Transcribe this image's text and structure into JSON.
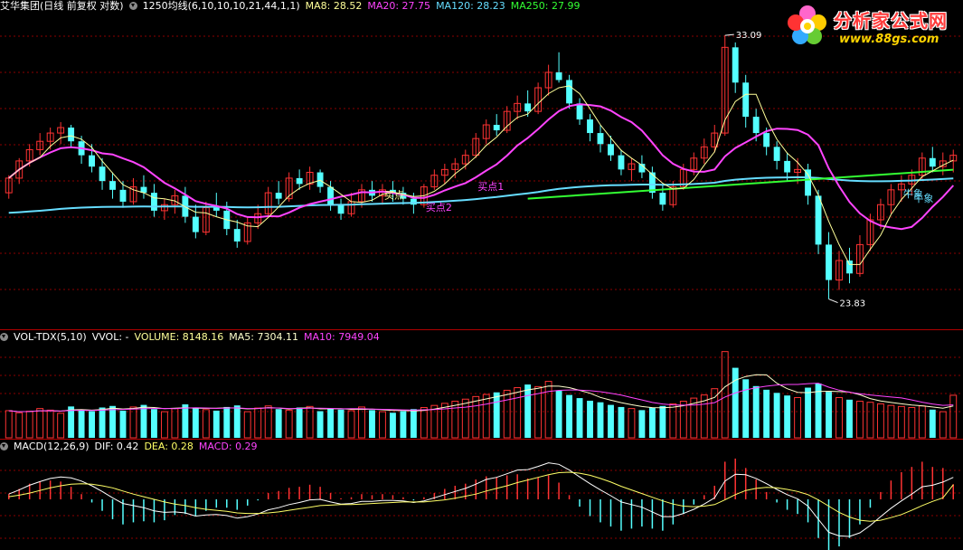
{
  "colors": {
    "up": "#ff3333",
    "down": "#54ffff",
    "ma8": "#ffff99",
    "ma20": "#ff44ff",
    "ma120": "#66ddff",
    "ma250": "#33ff33",
    "grid": "#8b0000",
    "text_white": "#ffffff"
  },
  "header": {
    "stock": "艾华集团(日线 前复权 对数)",
    "ma_set": "1250均线(6,10,10,10,21,44,1,1)",
    "ma8": "MA8: 28.52",
    "ma20": "MA20: 27.75",
    "ma120": "MA120: 28.23",
    "ma250": "MA250: 27.99"
  },
  "volume_header": {
    "name": "VOL-TDX(5,10)",
    "vvol": "VVOL: -",
    "volume": "VOLUME: 8148.16",
    "ma5": "MA5: 7304.11",
    "ma10": "MA10: 7949.04"
  },
  "macd_header": {
    "name": "MACD(12,26,9)",
    "dif": "DIF: 0.42",
    "dea": "DEA: 0.28",
    "macd": "MACD: 0.29"
  },
  "logo": {
    "title": "分析家公式网",
    "url": "www.88gs.com"
  },
  "chart_data": [
    {
      "type": "candlestick",
      "panel": "price",
      "scale": "log",
      "ylim": [
        23.0,
        34.0
      ],
      "annotations": [
        {
          "text": "33.09",
          "bar": 69,
          "price": 33.09
        },
        {
          "text": "23.83",
          "bar": 79,
          "price": 23.83
        },
        {
          "text": "买点1",
          "bar": 45,
          "price": 27.3
        },
        {
          "text": "买点2",
          "bar": 40,
          "price": 26.6
        },
        {
          "text": "买点",
          "bar": 36,
          "price": 27.0
        },
        {
          "text": "牛象",
          "bar": 86,
          "price": 27.05
        },
        {
          "text": "牛象",
          "bar": 87,
          "price": 26.9
        }
      ],
      "candles": [
        [
          27.2,
          27.8,
          27.0,
          27.7
        ],
        [
          27.7,
          28.4,
          27.5,
          28.3
        ],
        [
          28.3,
          28.9,
          28.1,
          28.7
        ],
        [
          28.7,
          29.3,
          28.5,
          29.0
        ],
        [
          29.0,
          29.5,
          28.7,
          29.3
        ],
        [
          29.3,
          29.7,
          28.9,
          29.5
        ],
        [
          29.5,
          29.6,
          28.8,
          29.0
        ],
        [
          29.0,
          29.2,
          28.2,
          28.5
        ],
        [
          28.5,
          28.9,
          27.9,
          28.1
        ],
        [
          28.1,
          28.4,
          27.3,
          27.6
        ],
        [
          27.6,
          27.9,
          27.0,
          27.3
        ],
        [
          27.3,
          27.6,
          26.7,
          26.9
        ],
        [
          26.9,
          27.7,
          26.8,
          27.4
        ],
        [
          27.4,
          27.8,
          27.0,
          27.2
        ],
        [
          27.2,
          27.5,
          26.4,
          26.6
        ],
        [
          26.6,
          27.0,
          26.3,
          26.8
        ],
        [
          26.8,
          27.3,
          26.5,
          27.1
        ],
        [
          27.1,
          27.4,
          26.2,
          26.4
        ],
        [
          26.4,
          26.8,
          25.7,
          25.9
        ],
        [
          25.9,
          26.9,
          25.8,
          26.7
        ],
        [
          26.7,
          27.2,
          26.4,
          26.6
        ],
        [
          26.6,
          26.9,
          25.8,
          26.0
        ],
        [
          26.0,
          26.3,
          25.4,
          25.6
        ],
        [
          25.6,
          26.4,
          25.5,
          26.2
        ],
        [
          26.2,
          26.8,
          26.0,
          26.5
        ],
        [
          26.5,
          27.4,
          26.4,
          27.2
        ],
        [
          27.2,
          27.6,
          26.8,
          27.0
        ],
        [
          27.0,
          27.9,
          26.9,
          27.7
        ],
        [
          27.7,
          28.0,
          27.3,
          27.5
        ],
        [
          27.5,
          28.1,
          27.3,
          27.9
        ],
        [
          27.9,
          28.0,
          27.2,
          27.4
        ],
        [
          27.4,
          27.6,
          26.6,
          26.8
        ],
        [
          26.8,
          27.0,
          26.3,
          26.5
        ],
        [
          26.5,
          27.2,
          26.4,
          26.9
        ],
        [
          26.9,
          27.5,
          26.7,
          27.3
        ],
        [
          27.3,
          27.6,
          26.9,
          27.1
        ],
        [
          27.1,
          27.5,
          26.8,
          27.3
        ],
        [
          27.3,
          27.6,
          26.9,
          27.2
        ],
        [
          27.2,
          27.4,
          26.8,
          27.0
        ],
        [
          27.0,
          27.2,
          26.5,
          26.8
        ],
        [
          26.8,
          27.5,
          26.7,
          27.4
        ],
        [
          27.4,
          28.0,
          27.3,
          27.8
        ],
        [
          27.8,
          28.2,
          27.5,
          28.0
        ],
        [
          28.0,
          28.4,
          27.7,
          28.2
        ],
        [
          28.2,
          28.7,
          28.0,
          28.5
        ],
        [
          28.5,
          29.3,
          28.4,
          29.1
        ],
        [
          29.1,
          29.8,
          28.9,
          29.6
        ],
        [
          29.6,
          30.0,
          29.2,
          29.4
        ],
        [
          29.4,
          30.3,
          29.3,
          30.1
        ],
        [
          30.1,
          30.7,
          29.8,
          30.4
        ],
        [
          30.4,
          30.9,
          29.9,
          30.1
        ],
        [
          30.1,
          31.2,
          30.0,
          31.0
        ],
        [
          31.0,
          31.9,
          30.7,
          31.6
        ],
        [
          31.6,
          32.4,
          31.2,
          31.3
        ],
        [
          31.3,
          31.5,
          30.2,
          30.4
        ],
        [
          30.4,
          30.6,
          29.6,
          29.8
        ],
        [
          29.8,
          30.0,
          29.0,
          29.3
        ],
        [
          29.3,
          29.6,
          28.6,
          28.9
        ],
        [
          28.9,
          29.2,
          28.3,
          28.5
        ],
        [
          28.5,
          28.7,
          27.8,
          28.0
        ],
        [
          28.0,
          28.4,
          27.6,
          28.2
        ],
        [
          28.2,
          28.5,
          27.7,
          27.9
        ],
        [
          27.9,
          28.1,
          27.0,
          27.2
        ],
        [
          27.2,
          27.5,
          26.6,
          26.8
        ],
        [
          26.8,
          27.6,
          26.7,
          27.4
        ],
        [
          27.4,
          28.2,
          27.3,
          28.0
        ],
        [
          28.0,
          28.6,
          27.8,
          28.4
        ],
        [
          28.4,
          29.1,
          28.2,
          28.8
        ],
        [
          28.8,
          29.6,
          28.6,
          29.3
        ],
        [
          29.3,
          33.09,
          29.2,
          32.6
        ],
        [
          32.6,
          32.8,
          30.8,
          31.2
        ],
        [
          31.2,
          31.5,
          29.5,
          29.9
        ],
        [
          29.9,
          30.2,
          29.0,
          29.3
        ],
        [
          29.3,
          29.5,
          28.5,
          28.8
        ],
        [
          28.8,
          29.0,
          28.0,
          28.3
        ],
        [
          28.3,
          28.6,
          27.6,
          27.9
        ],
        [
          27.9,
          28.4,
          27.5,
          28.0
        ],
        [
          28.0,
          28.2,
          26.8,
          27.1
        ],
        [
          27.1,
          27.3,
          25.2,
          25.5
        ],
        [
          25.5,
          25.9,
          23.83,
          24.4
        ],
        [
          24.4,
          25.3,
          24.1,
          25.0
        ],
        [
          25.0,
          25.4,
          24.3,
          24.6
        ],
        [
          24.6,
          25.8,
          24.5,
          25.5
        ],
        [
          25.5,
          26.5,
          25.3,
          26.3
        ],
        [
          26.3,
          27.0,
          26.0,
          26.8
        ],
        [
          26.8,
          27.5,
          26.5,
          27.3
        ],
        [
          27.3,
          27.8,
          26.9,
          27.5
        ],
        [
          27.5,
          28.0,
          27.1,
          27.8
        ],
        [
          27.8,
          28.6,
          27.6,
          28.4
        ],
        [
          28.4,
          28.8,
          27.9,
          28.1
        ],
        [
          28.1,
          28.6,
          27.8,
          28.3
        ],
        [
          28.3,
          28.7,
          27.9,
          28.5
        ]
      ],
      "ma250": [
        {
          "bar": 50,
          "value": 27.0
        },
        {
          "bar": 91,
          "value": 27.99
        }
      ]
    },
    {
      "type": "bar",
      "panel": "volume",
      "ylim": [
        0,
        18000
      ],
      "values": [
        5200,
        4800,
        5100,
        5600,
        5300,
        4700,
        6000,
        5400,
        5100,
        5800,
        6100,
        5200,
        5900,
        6300,
        5500,
        5000,
        5600,
        6400,
        5800,
        5400,
        5200,
        5900,
        6200,
        5000,
        5700,
        6100,
        5500,
        5300,
        5800,
        6000,
        5100,
        5600,
        5400,
        5200,
        5900,
        5300,
        5000,
        4800,
        5100,
        5500,
        5800,
        6200,
        6600,
        7000,
        7400,
        7900,
        8300,
        8700,
        9100,
        9600,
        10200,
        9800,
        10800,
        9000,
        8200,
        7600,
        7100,
        6800,
        6300,
        5900,
        5600,
        5300,
        5800,
        6100,
        6500,
        7000,
        7600,
        8200,
        9400,
        16500,
        13400,
        11200,
        9900,
        9200,
        8600,
        8100,
        7700,
        9600,
        10400,
        8800,
        7700,
        7300,
        7000,
        6800,
        6500,
        6200,
        6000,
        5800,
        6100,
        5400,
        5000,
        8148.16
      ]
    },
    {
      "type": "bar",
      "panel": "macd",
      "ylim": [
        -0.9,
        0.9
      ],
      "series": [
        {
          "name": "DIF",
          "values": [
            0.1,
            0.18,
            0.27,
            0.34,
            0.4,
            0.43,
            0.41,
            0.35,
            0.26,
            0.15,
            0.03,
            -0.08,
            -0.12,
            -0.16,
            -0.22,
            -0.25,
            -0.24,
            -0.26,
            -0.32,
            -0.3,
            -0.29,
            -0.31,
            -0.36,
            -0.33,
            -0.28,
            -0.2,
            -0.16,
            -0.1,
            -0.06,
            -0.01,
            0.0,
            -0.05,
            -0.09,
            -0.08,
            -0.04,
            -0.04,
            -0.02,
            -0.02,
            -0.03,
            -0.06,
            -0.03,
            0.03,
            0.09,
            0.15,
            0.21,
            0.29,
            0.38,
            0.42,
            0.49,
            0.56,
            0.57,
            0.63,
            0.7,
            0.67,
            0.56,
            0.43,
            0.3,
            0.18,
            0.07,
            -0.05,
            -0.1,
            -0.15,
            -0.24,
            -0.33,
            -0.33,
            -0.27,
            -0.19,
            -0.09,
            0.03,
            0.35,
            0.48,
            0.47,
            0.4,
            0.3,
            0.19,
            0.09,
            0.01,
            -0.13,
            -0.38,
            -0.63,
            -0.7,
            -0.71,
            -0.64,
            -0.5,
            -0.33,
            -0.17,
            -0.03,
            0.1,
            0.24,
            0.27,
            0.33,
            0.42
          ]
        },
        {
          "name": "DEA",
          "values": [
            0.05,
            0.08,
            0.12,
            0.17,
            0.22,
            0.26,
            0.29,
            0.3,
            0.29,
            0.26,
            0.22,
            0.16,
            0.1,
            0.05,
            0.0,
            -0.05,
            -0.09,
            -0.12,
            -0.16,
            -0.19,
            -0.21,
            -0.23,
            -0.26,
            -0.27,
            -0.27,
            -0.26,
            -0.24,
            -0.21,
            -0.18,
            -0.15,
            -0.12,
            -0.11,
            -0.1,
            -0.1,
            -0.09,
            -0.08,
            -0.07,
            -0.06,
            -0.05,
            -0.05,
            -0.05,
            -0.03,
            -0.01,
            0.02,
            0.06,
            0.1,
            0.16,
            0.21,
            0.26,
            0.32,
            0.37,
            0.42,
            0.47,
            0.51,
            0.52,
            0.5,
            0.46,
            0.4,
            0.33,
            0.25,
            0.18,
            0.11,
            0.04,
            -0.03,
            -0.09,
            -0.13,
            -0.14,
            -0.13,
            -0.1,
            -0.01,
            0.09,
            0.17,
            0.21,
            0.23,
            0.22,
            0.19,
            0.15,
            0.09,
            -0.01,
            -0.13,
            -0.25,
            -0.34,
            -0.4,
            -0.42,
            -0.4,
            -0.35,
            -0.29,
            -0.21,
            -0.12,
            -0.04,
            0.03,
            0.28
          ]
        },
        {
          "name": "MACD",
          "values": [
            0.1,
            0.2,
            0.3,
            0.34,
            0.36,
            0.34,
            0.24,
            0.1,
            -0.06,
            -0.22,
            -0.38,
            -0.48,
            -0.44,
            -0.42,
            -0.44,
            -0.4,
            -0.3,
            -0.28,
            -0.32,
            -0.22,
            -0.16,
            -0.16,
            -0.2,
            -0.12,
            -0.02,
            0.12,
            0.16,
            0.22,
            0.24,
            0.28,
            0.24,
            0.12,
            0.02,
            0.04,
            0.1,
            0.08,
            0.1,
            0.08,
            0.04,
            -0.02,
            0.04,
            0.12,
            0.2,
            0.26,
            0.3,
            0.38,
            0.44,
            0.42,
            0.46,
            0.48,
            0.4,
            0.42,
            0.46,
            0.32,
            0.08,
            -0.14,
            -0.32,
            -0.44,
            -0.52,
            -0.6,
            -0.56,
            -0.52,
            -0.56,
            -0.6,
            -0.48,
            -0.28,
            -0.1,
            0.08,
            0.26,
            0.72,
            0.78,
            0.6,
            0.38,
            0.14,
            -0.06,
            -0.2,
            -0.28,
            -0.44,
            -0.74,
            -1.0,
            -0.9,
            -0.74,
            -0.48,
            -0.16,
            0.14,
            0.36,
            0.52,
            0.62,
            0.72,
            0.62,
            0.6,
            0.29
          ]
        }
      ]
    }
  ]
}
